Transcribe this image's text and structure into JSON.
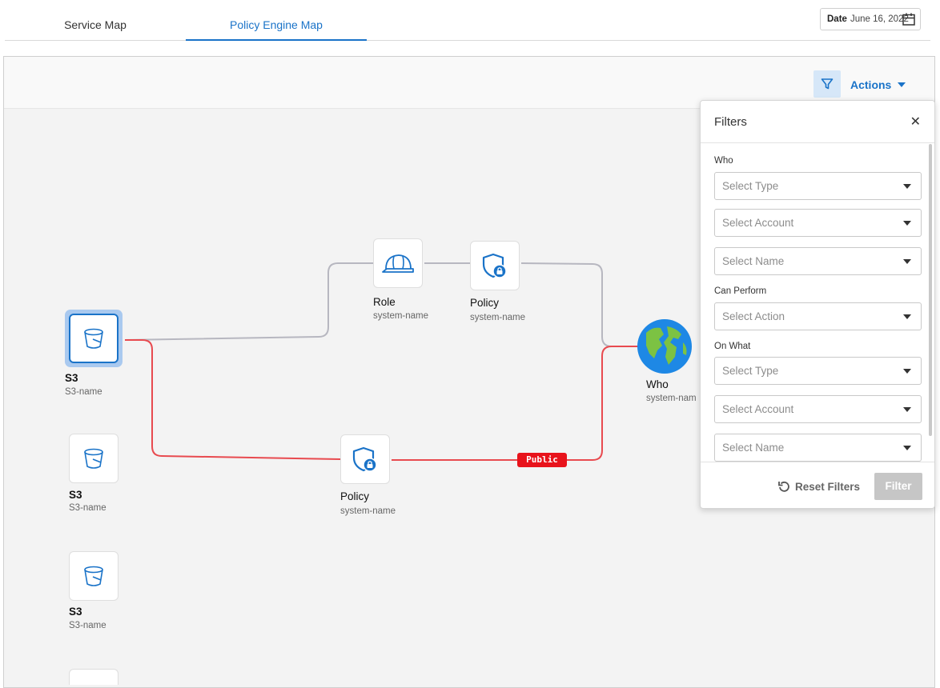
{
  "tabs": [
    {
      "label": "Service Map"
    },
    {
      "label": "Policy Engine Map"
    }
  ],
  "date": {
    "label": "Date",
    "value": "June 16, 2022",
    "icon": "calendar-icon"
  },
  "toolbar": {
    "filter_icon": "filter-icon",
    "actions_label": "Actions"
  },
  "nodes": {
    "s3_selected": {
      "title": "S3",
      "subtitle": "S3-name",
      "icon": "bucket-icon"
    },
    "s3_2": {
      "title": "S3",
      "subtitle": "S3-name",
      "icon": "bucket-icon"
    },
    "s3_3": {
      "title": "S3",
      "subtitle": "S3-name",
      "icon": "bucket-icon"
    },
    "role": {
      "title": "Role",
      "subtitle": "system-name",
      "icon": "hardhat-icon"
    },
    "policy_top": {
      "title": "Policy",
      "subtitle": "system-name",
      "icon": "shield-lock-icon"
    },
    "policy_bottom": {
      "title": "Policy",
      "subtitle": "system-name",
      "icon": "shield-lock-icon"
    },
    "who": {
      "title": "Who",
      "subtitle": "system-nam",
      "icon": "globe-icon"
    }
  },
  "edge_badge": "Public",
  "colors": {
    "accent": "#1a73c8",
    "public_edge": "#e84a4f",
    "normal_edge": "#b7b7c0",
    "badge": "#e8131b"
  },
  "filters": {
    "title": "Filters",
    "close_icon": "close-icon",
    "who": {
      "label": "Who",
      "type_placeholder": "Select Type",
      "account_placeholder": "Select Account",
      "name_placeholder": "Select Name"
    },
    "can_perform": {
      "label": "Can Perform",
      "action_placeholder": "Select Action"
    },
    "on_what": {
      "label": "On What",
      "type_placeholder": "Select Type",
      "account_placeholder": "Select Account",
      "name_placeholder": "Select Name"
    },
    "reset_label": "Reset Filters",
    "submit_label": "Filter"
  }
}
